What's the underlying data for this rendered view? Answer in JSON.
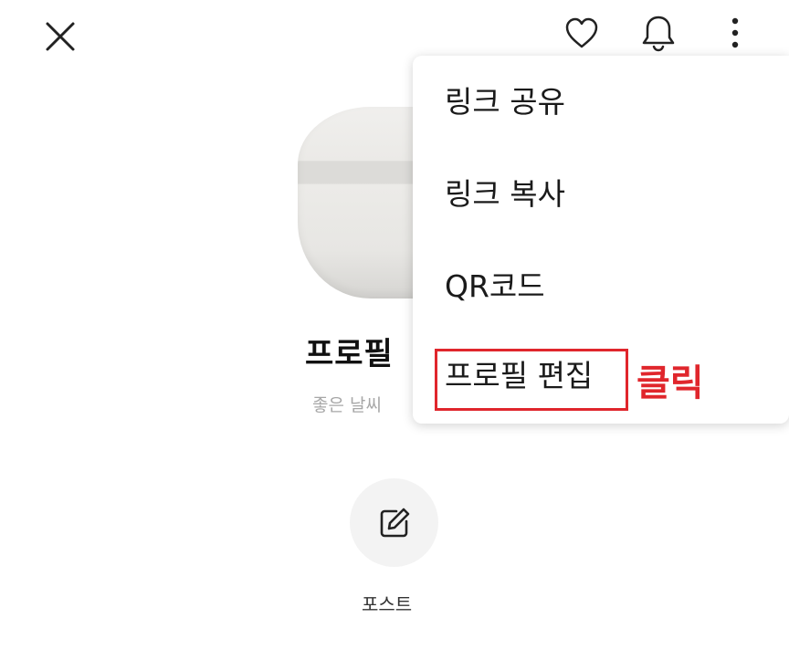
{
  "header": {
    "close_icon": "close-icon",
    "like_icon": "heart-icon",
    "notify_icon": "bell-icon",
    "more_icon": "more-vertical-icon"
  },
  "profile": {
    "name": "프로필",
    "status": "좋은 날씨"
  },
  "post_action": {
    "icon": "edit-icon",
    "label": "포스트"
  },
  "menu": {
    "items": [
      {
        "label": "링크 공유"
      },
      {
        "label": "링크 복사"
      },
      {
        "label": "QR코드"
      },
      {
        "label": "프로필 편집"
      }
    ]
  },
  "annotation": {
    "label": "클릭",
    "color": "#e0262c"
  }
}
